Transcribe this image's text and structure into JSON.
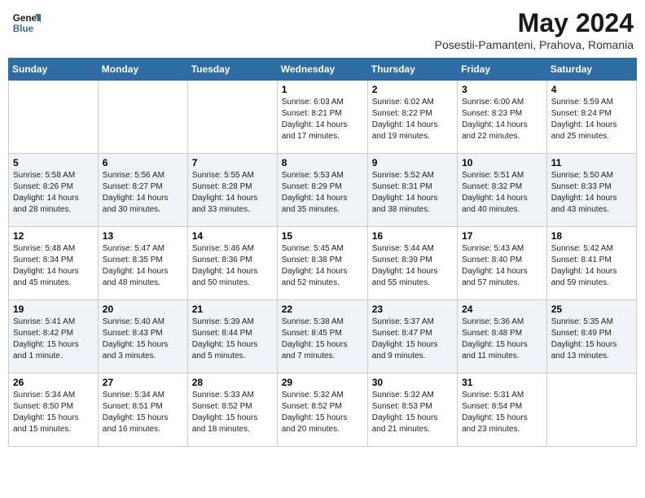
{
  "header": {
    "logo_line1": "General",
    "logo_line2": "Blue",
    "month_title": "May 2024",
    "subtitle": "Posestii-Pamanteni, Prahova, Romania"
  },
  "days_of_week": [
    "Sunday",
    "Monday",
    "Tuesday",
    "Wednesday",
    "Thursday",
    "Friday",
    "Saturday"
  ],
  "weeks": [
    [
      {
        "day": "",
        "info": ""
      },
      {
        "day": "",
        "info": ""
      },
      {
        "day": "",
        "info": ""
      },
      {
        "day": "1",
        "info": "Sunrise: 6:03 AM\nSunset: 8:21 PM\nDaylight: 14 hours and 17 minutes."
      },
      {
        "day": "2",
        "info": "Sunrise: 6:02 AM\nSunset: 8:22 PM\nDaylight: 14 hours and 19 minutes."
      },
      {
        "day": "3",
        "info": "Sunrise: 6:00 AM\nSunset: 8:23 PM\nDaylight: 14 hours and 22 minutes."
      },
      {
        "day": "4",
        "info": "Sunrise: 5:59 AM\nSunset: 8:24 PM\nDaylight: 14 hours and 25 minutes."
      }
    ],
    [
      {
        "day": "5",
        "info": "Sunrise: 5:58 AM\nSunset: 8:26 PM\nDaylight: 14 hours and 28 minutes."
      },
      {
        "day": "6",
        "info": "Sunrise: 5:56 AM\nSunset: 8:27 PM\nDaylight: 14 hours and 30 minutes."
      },
      {
        "day": "7",
        "info": "Sunrise: 5:55 AM\nSunset: 8:28 PM\nDaylight: 14 hours and 33 minutes."
      },
      {
        "day": "8",
        "info": "Sunrise: 5:53 AM\nSunset: 8:29 PM\nDaylight: 14 hours and 35 minutes."
      },
      {
        "day": "9",
        "info": "Sunrise: 5:52 AM\nSunset: 8:31 PM\nDaylight: 14 hours and 38 minutes."
      },
      {
        "day": "10",
        "info": "Sunrise: 5:51 AM\nSunset: 8:32 PM\nDaylight: 14 hours and 40 minutes."
      },
      {
        "day": "11",
        "info": "Sunrise: 5:50 AM\nSunset: 8:33 PM\nDaylight: 14 hours and 43 minutes."
      }
    ],
    [
      {
        "day": "12",
        "info": "Sunrise: 5:48 AM\nSunset: 8:34 PM\nDaylight: 14 hours and 45 minutes."
      },
      {
        "day": "13",
        "info": "Sunrise: 5:47 AM\nSunset: 8:35 PM\nDaylight: 14 hours and 48 minutes."
      },
      {
        "day": "14",
        "info": "Sunrise: 5:46 AM\nSunset: 8:36 PM\nDaylight: 14 hours and 50 minutes."
      },
      {
        "day": "15",
        "info": "Sunrise: 5:45 AM\nSunset: 8:38 PM\nDaylight: 14 hours and 52 minutes."
      },
      {
        "day": "16",
        "info": "Sunrise: 5:44 AM\nSunset: 8:39 PM\nDaylight: 14 hours and 55 minutes."
      },
      {
        "day": "17",
        "info": "Sunrise: 5:43 AM\nSunset: 8:40 PM\nDaylight: 14 hours and 57 minutes."
      },
      {
        "day": "18",
        "info": "Sunrise: 5:42 AM\nSunset: 8:41 PM\nDaylight: 14 hours and 59 minutes."
      }
    ],
    [
      {
        "day": "19",
        "info": "Sunrise: 5:41 AM\nSunset: 8:42 PM\nDaylight: 15 hours and 1 minute."
      },
      {
        "day": "20",
        "info": "Sunrise: 5:40 AM\nSunset: 8:43 PM\nDaylight: 15 hours and 3 minutes."
      },
      {
        "day": "21",
        "info": "Sunrise: 5:39 AM\nSunset: 8:44 PM\nDaylight: 15 hours and 5 minutes."
      },
      {
        "day": "22",
        "info": "Sunrise: 5:38 AM\nSunset: 8:45 PM\nDaylight: 15 hours and 7 minutes."
      },
      {
        "day": "23",
        "info": "Sunrise: 5:37 AM\nSunset: 8:47 PM\nDaylight: 15 hours and 9 minutes."
      },
      {
        "day": "24",
        "info": "Sunrise: 5:36 AM\nSunset: 8:48 PM\nDaylight: 15 hours and 11 minutes."
      },
      {
        "day": "25",
        "info": "Sunrise: 5:35 AM\nSunset: 8:49 PM\nDaylight: 15 hours and 13 minutes."
      }
    ],
    [
      {
        "day": "26",
        "info": "Sunrise: 5:34 AM\nSunset: 8:50 PM\nDaylight: 15 hours and 15 minutes."
      },
      {
        "day": "27",
        "info": "Sunrise: 5:34 AM\nSunset: 8:51 PM\nDaylight: 15 hours and 16 minutes."
      },
      {
        "day": "28",
        "info": "Sunrise: 5:33 AM\nSunset: 8:52 PM\nDaylight: 15 hours and 18 minutes."
      },
      {
        "day": "29",
        "info": "Sunrise: 5:32 AM\nSunset: 8:52 PM\nDaylight: 15 hours and 20 minutes."
      },
      {
        "day": "30",
        "info": "Sunrise: 5:32 AM\nSunset: 8:53 PM\nDaylight: 15 hours and 21 minutes."
      },
      {
        "day": "31",
        "info": "Sunrise: 5:31 AM\nSunset: 8:54 PM\nDaylight: 15 hours and 23 minutes."
      },
      {
        "day": "",
        "info": ""
      }
    ]
  ]
}
